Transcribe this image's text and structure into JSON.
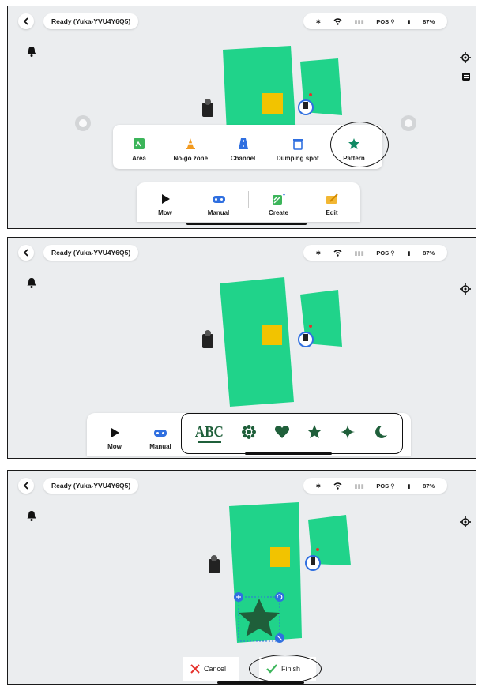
{
  "status": {
    "text": "Ready  (Yuka-YVU4Y6Q5)",
    "pos_label": "POS",
    "battery": "87%"
  },
  "panel1": {
    "create_menu": [
      {
        "label": "Area",
        "icon": "area-icon"
      },
      {
        "label": "No-go zone",
        "icon": "traffic-cone-icon"
      },
      {
        "label": "Channel",
        "icon": "channel-icon"
      },
      {
        "label": "Dumping spot",
        "icon": "trash-icon"
      },
      {
        "label": "Pattern",
        "icon": "star-icon"
      }
    ],
    "bottom_tabs": [
      {
        "label": "Mow",
        "icon": "play-icon"
      },
      {
        "label": "Manual",
        "icon": "gamepad-icon"
      },
      {
        "label": "Create",
        "icon": "create-icon"
      },
      {
        "label": "Edit",
        "icon": "edit-icon"
      }
    ]
  },
  "panel2": {
    "bottom_tabs": [
      {
        "label": "Mow",
        "icon": "play-icon"
      },
      {
        "label": "Manual",
        "icon": "gamepad-icon"
      }
    ],
    "patterns": [
      {
        "label": "ABC",
        "icon": "text-pattern-icon"
      },
      {
        "icon": "flower-pattern-icon"
      },
      {
        "icon": "heart-pattern-icon"
      },
      {
        "icon": "star-pattern-icon"
      },
      {
        "icon": "sparkle-pattern-icon"
      },
      {
        "icon": "moon-pattern-icon"
      }
    ]
  },
  "panel3": {
    "cancel_label": "Cancel",
    "finish_label": "Finish"
  },
  "colors": {
    "lawn": "#20d38a",
    "lawn_edge": "#16b874",
    "accent_blue": "#2f6fe0",
    "cancel_red": "#e5322d",
    "finish_green": "#3cb55a",
    "pattern_dark": "#1f5f3a",
    "yellow_block": "#f2c300"
  }
}
